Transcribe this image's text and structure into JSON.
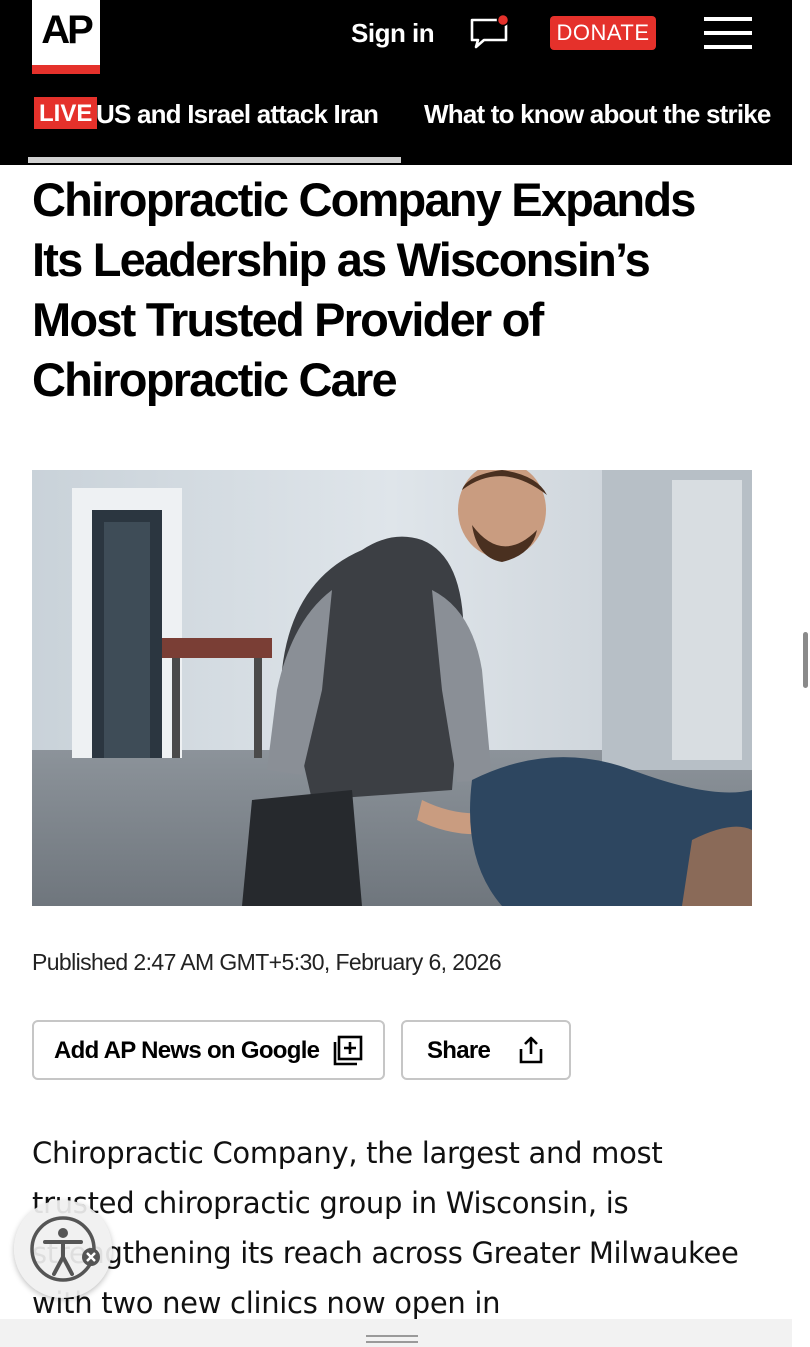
{
  "header": {
    "logo_text": "AP",
    "signin_label": "Sign in",
    "donate_label": "DONATE",
    "icons": [
      "chat-bubble-icon",
      "hamburger-menu-icon"
    ],
    "colors": {
      "background": "#000000",
      "accent": "#e5312b"
    }
  },
  "ticker": {
    "live_badge": "LIVE",
    "items": [
      "US and Israel attack Iran",
      "What to know about the strike"
    ]
  },
  "article": {
    "headline": "Chiropractic Company Expands Its Leadership as Wisconsin’s Most Trusted Provider of Chiropractic Care",
    "published": "Published 2:47 AM GMT+5:30, February 6, 2026",
    "actions": {
      "google_label": "Add AP News on Google",
      "share_label": "Share"
    },
    "body_text": "Chiropractic Company, the largest and most trusted chiropractic group in Wisconsin, is strengthening its reach across Greater Milwaukee with two new clinics now open in"
  },
  "accessibility": {
    "icon": "accessibility-person-icon"
  }
}
